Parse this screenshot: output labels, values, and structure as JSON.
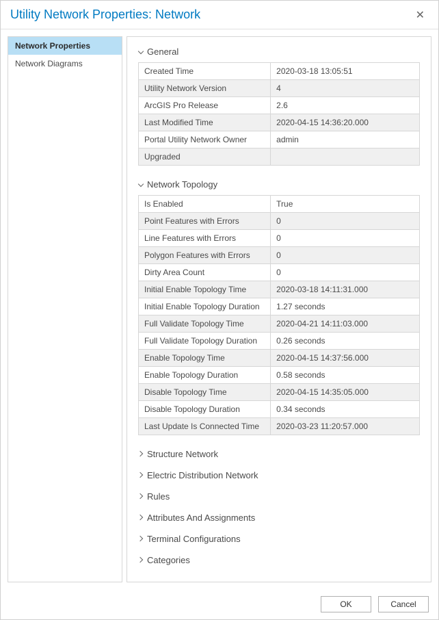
{
  "title": "Utility Network Properties: Network",
  "sidebar": {
    "items": [
      {
        "label": "Network Properties",
        "active": true
      },
      {
        "label": "Network Diagrams",
        "active": false
      }
    ]
  },
  "sections": {
    "general": {
      "title": "General",
      "rows": [
        {
          "label": "Created Time",
          "value": "2020-03-18 13:05:51"
        },
        {
          "label": "Utility Network Version",
          "value": "4"
        },
        {
          "label": "ArcGIS Pro Release",
          "value": "2.6"
        },
        {
          "label": "Last Modified Time",
          "value": "2020-04-15 14:36:20.000"
        },
        {
          "label": "Portal Utility Network Owner",
          "value": "admin"
        },
        {
          "label": "Upgraded",
          "value": ""
        }
      ]
    },
    "topology": {
      "title": "Network Topology",
      "rows": [
        {
          "label": "Is Enabled",
          "value": "True"
        },
        {
          "label": "Point Features with Errors",
          "value": "0"
        },
        {
          "label": "Line Features with Errors",
          "value": "0"
        },
        {
          "label": "Polygon Features with Errors",
          "value": "0"
        },
        {
          "label": "Dirty Area Count",
          "value": "0"
        },
        {
          "label": "Initial Enable Topology Time",
          "value": "2020-03-18 14:11:31.000"
        },
        {
          "label": "Initial Enable Topology Duration",
          "value": "1.27 seconds"
        },
        {
          "label": "Full Validate Topology Time",
          "value": "2020-04-21 14:11:03.000"
        },
        {
          "label": "Full Validate Topology Duration",
          "value": "0.26 seconds"
        },
        {
          "label": "Enable Topology Time",
          "value": "2020-04-15 14:37:56.000"
        },
        {
          "label": "Enable Topology Duration",
          "value": "0.58 seconds"
        },
        {
          "label": "Disable Topology Time",
          "value": "2020-04-15 14:35:05.000"
        },
        {
          "label": "Disable Topology Duration",
          "value": "0.34 seconds"
        },
        {
          "label": "Last Update Is Connected Time",
          "value": "2020-03-23 11:20:57.000"
        }
      ]
    },
    "collapsed": [
      {
        "title": "Structure Network"
      },
      {
        "title": "Electric Distribution Network"
      },
      {
        "title": "Rules"
      },
      {
        "title": "Attributes And Assignments"
      },
      {
        "title": "Terminal Configurations"
      },
      {
        "title": "Categories"
      }
    ]
  },
  "buttons": {
    "ok": "OK",
    "cancel": "Cancel"
  }
}
